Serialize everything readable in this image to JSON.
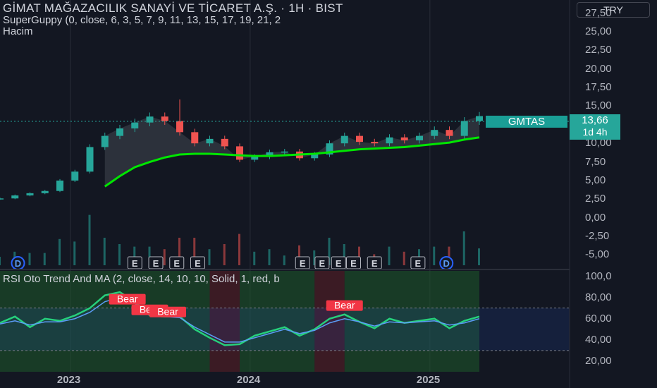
{
  "header": {
    "title": "GİMAT MAĞAZACILIK SANAYİ VE TİCARET A.Ş. · 1H · BIST",
    "indicator": "SuperGuppy (0, close, 6, 3, 5, 7, 9, 11, 13, 15, 17, 19, 21, 2",
    "volume_label": "Hacim"
  },
  "currency": "TRY",
  "symbol": "GMTAS",
  "last_price": "13,66",
  "bar_countdown": "1d 4h",
  "rsi_panel": {
    "title": "RSI Oto Trend And MA (2, close, 14, 10, 10, Solid, 1, red, b"
  },
  "price_axis_ticks": [
    "27,50",
    "25,00",
    "22,50",
    "20,00",
    "17,50",
    "15,00",
    "10,00",
    "7,50",
    "5,00",
    "2,50",
    "0,00",
    "-2,50",
    "-5,00"
  ],
  "rsi_axis_ticks": [
    "100,0",
    "80,00",
    "60,00",
    "40,00",
    "20,00"
  ],
  "x_axis_labels": [
    "2023",
    "2024",
    "2025"
  ],
  "event_markers": [
    "D",
    "E",
    "E",
    "E",
    "E",
    "E",
    "E",
    "E",
    "E",
    "E",
    "E",
    "D"
  ],
  "signal_labels": [
    "Bear",
    "Bear",
    "Bear",
    "Bear"
  ],
  "colors": {
    "background": "#131722",
    "up_candle": "#26a69a",
    "down_candle": "#ef5350",
    "guppy_ema": "#00e600",
    "rsi_line": "#26d07c",
    "rsi_ma": "#5b9cf6",
    "bear_label": "#f23645",
    "bull_zone": "#1e5a2a",
    "bear_zone": "#5c1f26"
  },
  "chart_data": [
    {
      "type": "candlestick",
      "title": "GİMAT MAĞAZACILIK SANAYİ VE TİCARET A.Ş. · 1H · BIST",
      "currency": "TRY",
      "ylim": [
        -6,
        28.5
      ],
      "x": [
        "2022-01",
        "2022-04",
        "2022-07",
        "2022-10",
        "2022-12",
        "2023-01",
        "2023-02",
        "2023-03",
        "2023-04",
        "2023-05",
        "2023-06",
        "2023-07",
        "2023-08",
        "2023-09",
        "2023-10",
        "2023-11",
        "2023-12",
        "2024-01",
        "2024-02",
        "2024-03",
        "2024-04",
        "2024-05",
        "2024-06",
        "2024-07",
        "2024-08",
        "2024-09",
        "2024-10",
        "2024-11",
        "2024-12",
        "2025-01",
        "2025-02",
        "2025-03",
        "2025-04"
      ],
      "close": [
        2.6,
        3.0,
        3.3,
        3.6,
        5.0,
        6.2,
        9.5,
        11.0,
        12.0,
        12.8,
        13.6,
        13.0,
        11.5,
        10.0,
        10.6,
        9.6,
        7.8,
        8.2,
        8.8,
        8.9,
        8.0,
        8.5,
        10.0,
        11.0,
        10.2,
        10.0,
        10.8,
        10.4,
        11.0,
        11.8,
        11.0,
        13.0,
        13.66
      ],
      "high_max": 15.9,
      "guppy_ema": [
        null,
        null,
        null,
        null,
        null,
        null,
        null,
        4.2,
        5.6,
        6.8,
        7.5,
        8.1,
        8.5,
        8.6,
        8.6,
        8.5,
        8.4,
        8.3,
        8.3,
        8.4,
        8.5,
        8.6,
        8.8,
        9.0,
        9.2,
        9.3,
        9.4,
        9.5,
        9.7,
        9.9,
        10.1,
        10.5,
        10.8
      ],
      "last": 13.66,
      "volume_series_name": "Hacim"
    },
    {
      "type": "line",
      "title": "RSI Oto Trend And MA (2, close, 14, 10, 10, Solid, 1, red, b",
      "ylim": [
        10,
        105
      ],
      "x": [
        "2022-01",
        "2022-04",
        "2022-07",
        "2022-10",
        "2022-12",
        "2023-01",
        "2023-02",
        "2023-03",
        "2023-04",
        "2023-05",
        "2023-06",
        "2023-07",
        "2023-08",
        "2023-09",
        "2023-10",
        "2023-11",
        "2023-12",
        "2024-01",
        "2024-02",
        "2024-03",
        "2024-04",
        "2024-05",
        "2024-06",
        "2024-07",
        "2024-08",
        "2024-09",
        "2024-10",
        "2024-11",
        "2024-12",
        "2025-01",
        "2025-02",
        "2025-03",
        "2025-04"
      ],
      "series": [
        {
          "values": [
            56,
            62,
            52,
            60,
            58,
            63,
            70,
            82,
            85,
            76,
            63,
            62,
            62,
            50,
            42,
            35,
            36,
            44,
            48,
            52,
            44,
            50,
            60,
            64,
            57,
            51,
            60,
            56,
            58,
            60,
            51,
            58,
            62
          ]
        },
        {
          "values": [
            55,
            58,
            54,
            57,
            57,
            60,
            66,
            76,
            80,
            74,
            64,
            62,
            61,
            52,
            45,
            38,
            38,
            42,
            46,
            50,
            46,
            49,
            56,
            60,
            57,
            53,
            57,
            56,
            57,
            58,
            54,
            56,
            60
          ]
        }
      ],
      "levels": [
        70,
        30
      ]
    }
  ]
}
